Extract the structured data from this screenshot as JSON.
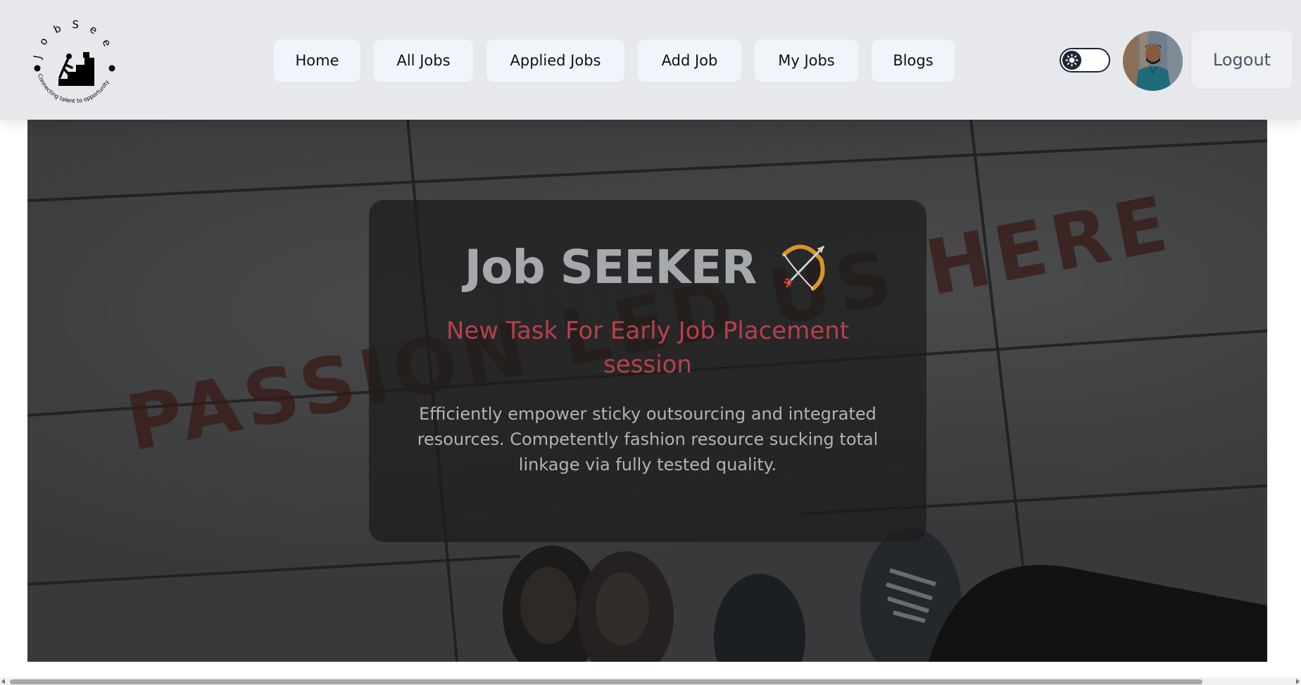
{
  "brand": {
    "logo_ring_text": "Job Seeker",
    "logo_tagline": "Connecting talent to opportunity"
  },
  "nav": {
    "items": [
      {
        "label": "Home"
      },
      {
        "label": "All Jobs"
      },
      {
        "label": "Applied Jobs"
      },
      {
        "label": "Add Job"
      },
      {
        "label": "My Jobs"
      },
      {
        "label": "Blogs"
      }
    ],
    "logout_label": "Logout"
  },
  "theme_toggle": {
    "state": "light",
    "icon": "sun-icon"
  },
  "hero": {
    "background_text": "PASSION LED US HERE",
    "title": "Job SEEKER",
    "title_icon": "bow-and-arrow-icon",
    "subtitle": "New Task For Early Job Placement session",
    "description": "Efficiently empower sticky outsourcing and integrated resources. Competently fashion resource sucking total linkage via fully tested quality."
  },
  "colors": {
    "navbar_bg": "#e6e8ec",
    "nav_button_bg": "#f0f5fc",
    "subtitle": "#b8404a",
    "title": "#a5a8ad"
  }
}
